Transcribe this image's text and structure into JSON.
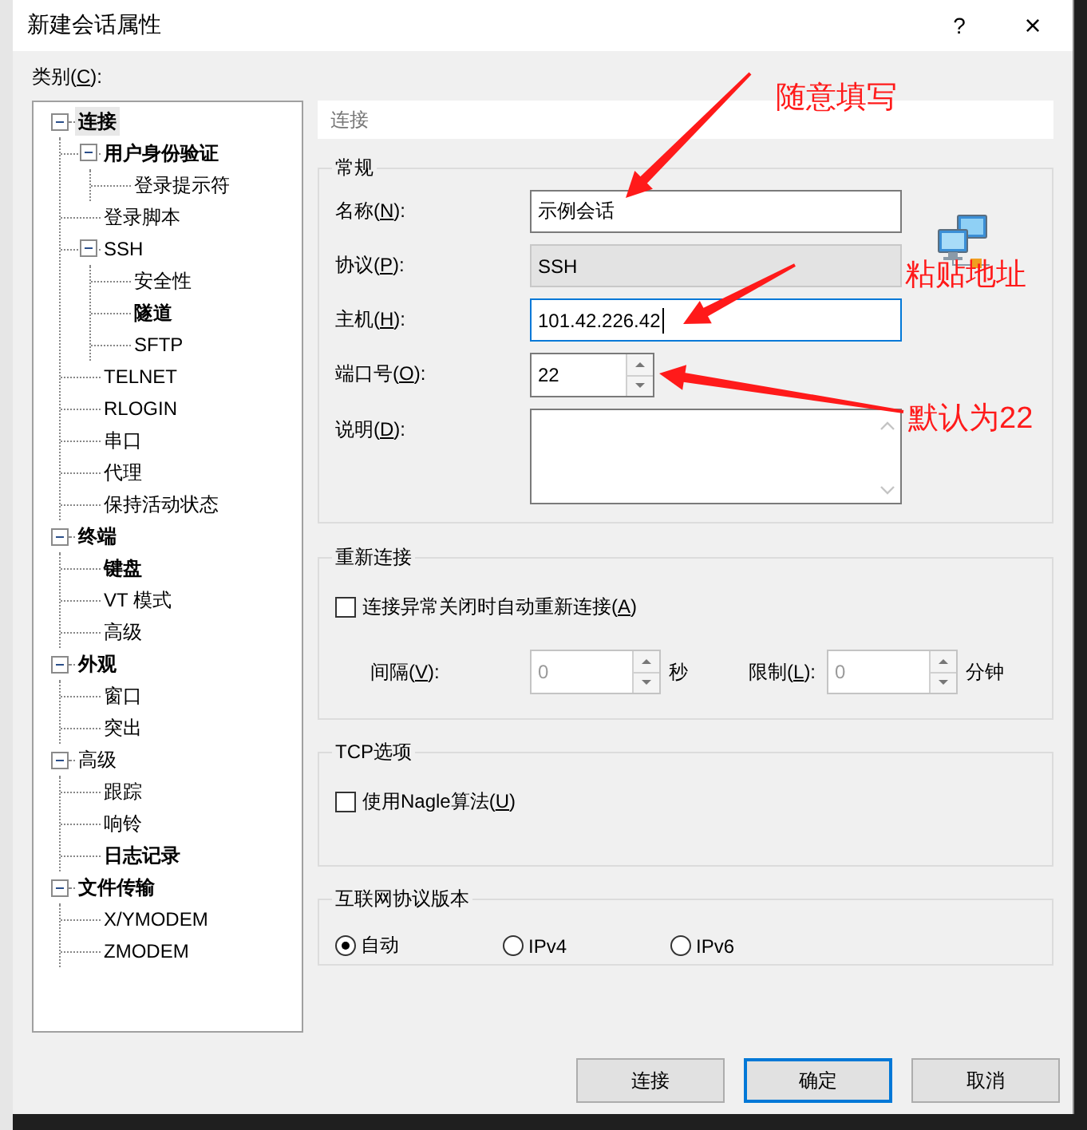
{
  "window": {
    "title": "新建会话属性",
    "help": "?",
    "close": "×"
  },
  "category_label": {
    "pre": "类别(",
    "key": "C",
    "post": "):"
  },
  "tree": [
    {
      "label": "连接",
      "bold": true,
      "selected": true,
      "expanded": true,
      "children": [
        {
          "label": "用户身份验证",
          "bold": true,
          "selected": false,
          "expanded": true,
          "children": [
            {
              "label": "登录提示符",
              "bold": false,
              "selected": false
            }
          ]
        },
        {
          "label": "登录脚本",
          "bold": false,
          "selected": false
        },
        {
          "label": "SSH",
          "bold": false,
          "selected": false,
          "expanded": true,
          "children": [
            {
              "label": "安全性",
              "bold": false,
              "selected": false
            },
            {
              "label": "隧道",
              "bold": true,
              "selected": false
            },
            {
              "label": "SFTP",
              "bold": false,
              "selected": false
            }
          ]
        },
        {
          "label": "TELNET",
          "bold": false,
          "selected": false
        },
        {
          "label": "RLOGIN",
          "bold": false,
          "selected": false
        },
        {
          "label": "串口",
          "bold": false,
          "selected": false
        },
        {
          "label": "代理",
          "bold": false,
          "selected": false
        },
        {
          "label": "保持活动状态",
          "bold": false,
          "selected": false
        }
      ]
    },
    {
      "label": "终端",
      "bold": true,
      "selected": false,
      "expanded": true,
      "children": [
        {
          "label": "键盘",
          "bold": true,
          "selected": false
        },
        {
          "label": "VT 模式",
          "bold": false,
          "selected": false
        },
        {
          "label": "高级",
          "bold": false,
          "selected": false
        }
      ]
    },
    {
      "label": "外观",
      "bold": true,
      "selected": false,
      "expanded": true,
      "children": [
        {
          "label": "窗口",
          "bold": false,
          "selected": false
        },
        {
          "label": "突出",
          "bold": false,
          "selected": false
        }
      ]
    },
    {
      "label": "高级",
      "bold": false,
      "selected": false,
      "expanded": true,
      "children": [
        {
          "label": "跟踪",
          "bold": false,
          "selected": false
        },
        {
          "label": "响铃",
          "bold": false,
          "selected": false
        },
        {
          "label": "日志记录",
          "bold": true,
          "selected": false
        }
      ]
    },
    {
      "label": "文件传输",
      "bold": true,
      "selected": false,
      "expanded": true,
      "children": [
        {
          "label": "X/YMODEM",
          "bold": false,
          "selected": false
        },
        {
          "label": "ZMODEM",
          "bold": false,
          "selected": false
        }
      ]
    }
  ],
  "panel_header": "连接",
  "general": {
    "title": "常规",
    "fields": [
      {
        "kind": "text",
        "pre": "名称(",
        "key": "N",
        "post": "):",
        "value": "示例会话",
        "focused": false
      },
      {
        "kind": "readonly",
        "pre": "协议(",
        "key": "P",
        "post": "):",
        "value": "SSH"
      },
      {
        "kind": "text",
        "pre": "主机(",
        "key": "H",
        "post": "):",
        "value": "101.42.226.42",
        "focused": true
      },
      {
        "kind": "spin",
        "pre": "端口号(",
        "key": "O",
        "post": "):",
        "value": "22"
      },
      {
        "kind": "memo",
        "pre": "说明(",
        "key": "D",
        "post": "):"
      }
    ]
  },
  "reconnect": {
    "title": "重新连接",
    "checkbox": {
      "pre": "连接异常关闭时自动重新连接(",
      "key": "A",
      "post": ")",
      "checked": false
    },
    "spins": [
      {
        "pre": "间隔(",
        "key": "V",
        "post": "):",
        "value": "0",
        "unit": "秒",
        "disabled": true
      },
      {
        "pre": "限制(",
        "key": "L",
        "post": "):",
        "value": "0",
        "unit": "分钟",
        "disabled": true
      }
    ]
  },
  "tcp": {
    "title": "TCP选项",
    "checkbox": {
      "pre": "使用Nagle算法(",
      "key": "U",
      "post": ")",
      "checked": false
    }
  },
  "ip_version": {
    "title": "互联网协议版本",
    "options": [
      {
        "label": "自动",
        "selected": true
      },
      {
        "label": "IPv4",
        "selected": false
      },
      {
        "label": "IPv6",
        "selected": false
      }
    ]
  },
  "buttons": [
    {
      "label": "连接",
      "default": false
    },
    {
      "label": "确定",
      "default": true
    },
    {
      "label": "取消",
      "default": false
    }
  ],
  "annotations": [
    {
      "text": "随意填写"
    },
    {
      "text": "粘贴地址"
    },
    {
      "text": "默认为22"
    }
  ]
}
